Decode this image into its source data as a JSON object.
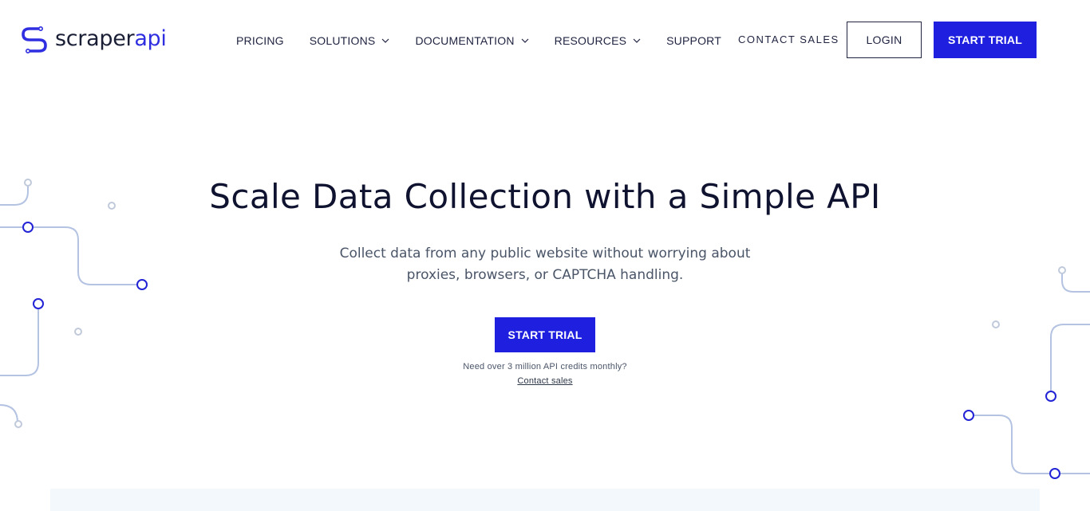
{
  "logo": {
    "part1": "scraper",
    "part2": "api",
    "icon": "scraperapi-s-logo-icon"
  },
  "nav": {
    "pricing": "PRICING",
    "solutions": "SOLUTIONS",
    "documentation": "DOCUMENTATION",
    "resources": "RESOURCES",
    "support": "SUPPORT",
    "dropdown_icon": "chevron-down-icon"
  },
  "header": {
    "contact_sales": "CONTACT SALES",
    "login": "LOGIN",
    "start_trial": "START TRIAL"
  },
  "hero": {
    "title": "Scale Data Collection with a Simple API",
    "subtitle_line1": "Collect data from any public website without worrying about",
    "subtitle_line2": "proxies, browsers, or CAPTCHA handling.",
    "cta": "START TRIAL",
    "credits_note": "Need over 3 million API credits monthly?",
    "contact_link": "Contact sales"
  },
  "colors": {
    "brand_blue": "#1f1fe0",
    "dark_text": "#0f1330",
    "body_text": "#4a5568",
    "circuit_line": "#aebfe0",
    "circuit_node": "#2323d6"
  }
}
